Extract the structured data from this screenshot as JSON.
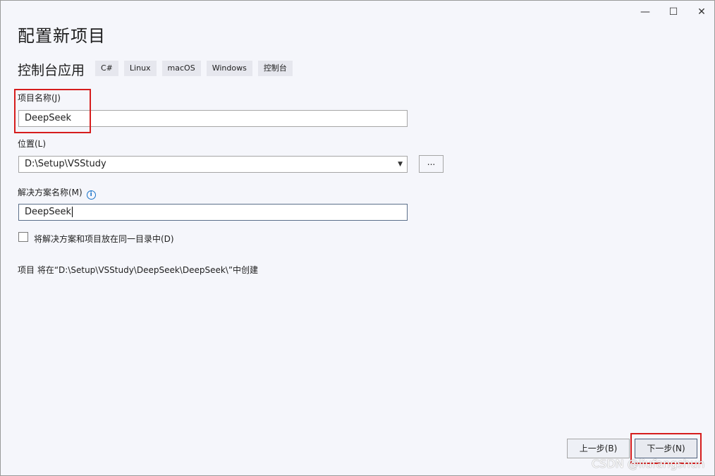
{
  "window": {
    "title": "配置新项目",
    "controls": {
      "minimize": "—",
      "maximize": "☐",
      "close": "✕"
    }
  },
  "template": {
    "name": "控制台应用",
    "tags": [
      "C#",
      "Linux",
      "macOS",
      "Windows",
      "控制台"
    ]
  },
  "form": {
    "project_name_label": "项目名称(J)",
    "project_name_value": "DeepSeek",
    "location_label": "位置(L)",
    "location_value": "D:\\Setup\\VSStudy",
    "browse_label": "...",
    "solution_name_label": "解决方案名称(M)",
    "solution_name_value": "DeepSeek",
    "same_dir_label": "将解决方案和项目放在同一目录中(D)",
    "same_dir_checked": false,
    "path_info": "项目 将在“D:\\Setup\\VSStudy\\DeepSeek\\DeepSeek\\”中创建"
  },
  "footer": {
    "back_label": "上一步(B)",
    "next_label": "下一步(N)"
  },
  "watermark": "CSDN @liufangshun",
  "colors": {
    "annotation_red": "#d61d1d",
    "info_blue": "#1a73c9",
    "background": "#f5f6fb"
  }
}
